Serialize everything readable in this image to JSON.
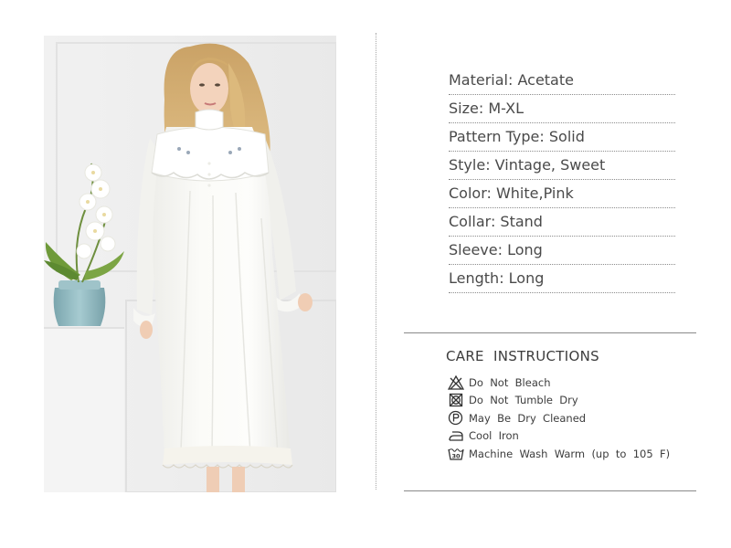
{
  "specs": [
    {
      "label": "Material: Acetate"
    },
    {
      "label": "Size: M-XL"
    },
    {
      "label": "Pattern Type: Solid"
    },
    {
      "label": "Style: Vintage, Sweet"
    },
    {
      "label": "Color: White,Pink"
    },
    {
      "label": "Collar: Stand"
    },
    {
      "label": "Sleeve: Long"
    },
    {
      "label": "Length: Long"
    }
  ],
  "care": {
    "title": "CARE  INSTRUCTIONS",
    "items": [
      {
        "icon": "do-not-bleach-icon",
        "text": "Do  Not  Bleach"
      },
      {
        "icon": "do-not-tumble-dry-icon",
        "text": "Do  Not  Tumble  Dry"
      },
      {
        "icon": "dry-clean-icon",
        "text": "May  Be  Dry  Cleaned"
      },
      {
        "icon": "cool-iron-icon",
        "text": "Cool  Iron"
      },
      {
        "icon": "machine-wash-icon",
        "text": "Machine  Wash  Warm  (up  to  105  F)",
        "icon_label": "30"
      }
    ]
  },
  "colors": {
    "text": "#4a4a4a",
    "rule": "#8a8a8a",
    "dress": "#fbfbf8",
    "hair": "#d6b071",
    "vase": "#8fb8c0",
    "wall": "#eeeeee"
  }
}
